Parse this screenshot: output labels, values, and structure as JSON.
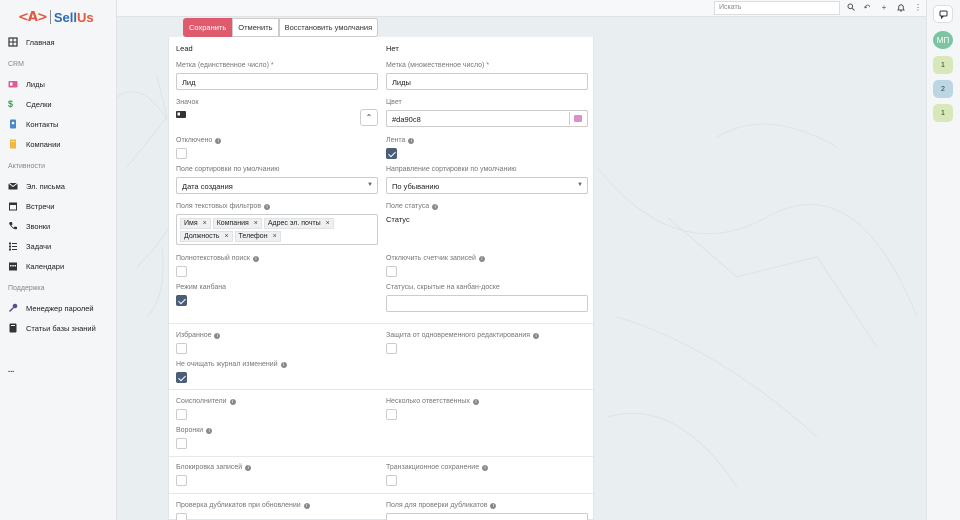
{
  "app": {
    "logo_mark": "<A>",
    "logo_name_a": "Sell",
    "logo_name_b": "Us"
  },
  "sidebar": {
    "home": "Главная",
    "sections": [
      "CRM",
      "Активности",
      "Поддержка"
    ],
    "crm": [
      "Лиды",
      "Сделки",
      "Контакты",
      "Компании"
    ],
    "activities": [
      "Эл. письма",
      "Встречи",
      "Звонки",
      "Задачи",
      "Календари"
    ],
    "support": [
      "Менеджер паролей",
      "Статьи базы знаний"
    ],
    "more": "..."
  },
  "topbar": {
    "search_placeholder": "Искать"
  },
  "rightbar": {
    "avatar": "МП",
    "badges": [
      "1",
      "2",
      "1"
    ]
  },
  "toolbar": {
    "save": "Сохранить",
    "cancel": "Отменить",
    "reset": "Восстановить умолчания"
  },
  "form": {
    "name_value": "Lead",
    "stream_value": "Нет",
    "label_single": "Метка (единственное число) *",
    "label_single_value": "Лид",
    "label_plural": "Метка (множественное число) *",
    "label_plural_value": "Лиды",
    "icon_label": "Значок",
    "color_label": "Цвет",
    "color_value": "#da90c8",
    "disabled_label": "Отключено",
    "stream_label": "Лента",
    "sort_by_label": "Поле сортировки по умолчанию",
    "sort_by_value": "Дата создания",
    "sort_dir_label": "Направление сортировки по умолчанию",
    "sort_dir_value": "По убыванию",
    "text_filters_label": "Поля текстовых фильтров",
    "text_filters": [
      "Имя",
      "Компания",
      "Адрес эл. почты",
      "Должность",
      "Телефон"
    ],
    "status_field_label": "Поле статуса",
    "status_field_value": "Статус",
    "fulltext_label": "Полнотекстовый поиск",
    "count_disabled_label": "Отключить счетчик записей",
    "kanban_label": "Режим канбана",
    "kanban_hidden_label": "Статусы, скрытые на канбан-доске",
    "favorites_label": "Избранное",
    "concurrent_label": "Защита от одновременного редактирования",
    "keep_audit_label": "Не очищать журнал изменений",
    "collaborators_label": "Соисполнители",
    "multiple_assigned_label": "Несколько ответственных",
    "funnels_label": "Воронки",
    "lock_label": "Блокировка записей",
    "transactional_label": "Транзакционное сохранение",
    "dup_check_label": "Проверка дубликатов при обновлении",
    "dup_fields_label": "Поля для проверки дубликатов"
  },
  "colors": {
    "accent": "#e05a6d",
    "checkbox": "#4b5e78",
    "swatch": "#da90c8"
  }
}
